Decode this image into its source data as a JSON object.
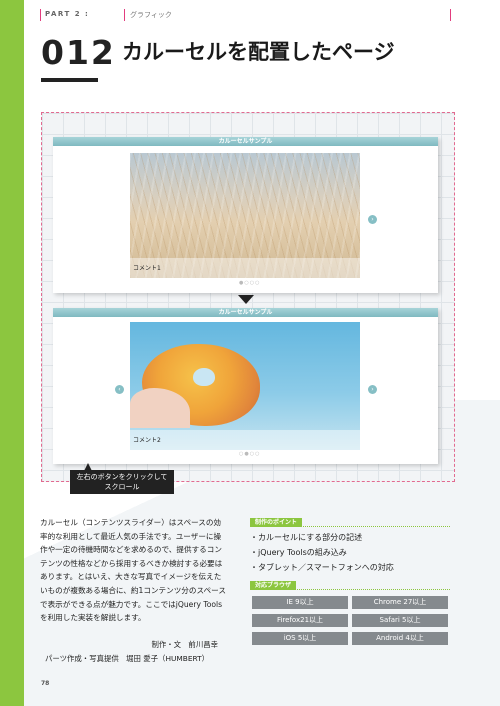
{
  "header": {
    "part": "PART 2 :",
    "category": "グラフィック",
    "number": "012",
    "title": "カルーセルを配置したページ"
  },
  "preview": {
    "carousel_top": {
      "heading": "カルーセルサンプル",
      "comment": "コメント1",
      "next_arrow": "›"
    },
    "carousel_bottom": {
      "heading": "カルーセルサンプル",
      "comment": "コメント2",
      "prev_arrow": "‹",
      "next_arrow": "›"
    },
    "callout_line1": "左右のボタンをクリックして",
    "callout_line2": "スクロール"
  },
  "body_text": "カルーセル（コンテンツスライダー）はスペースの効率的な利用として最近人気の手法です。ユーザーに操作や一定の待機時間などを求めるので、提供するコンテンツの性格などから採用するべきか検討する必要はあります。とはいえ、大きな写真でイメージを伝えたいものが複数ある場合に、約1コンテンツ分のスペースで表示ができる点が魅力です。ここではjQuery Toolsを利用した実装を解説します。",
  "credits": {
    "line1": "制作・文　前川昌幸",
    "line2": "パーツ作成・写真提供　堀田 愛子（HUMBERT）"
  },
  "points": {
    "label": "制作のポイント",
    "items": [
      "・カルーセルにする部分の記述",
      "・jQuery Toolsの組み込み",
      "・タブレット／スマートフォンへの対応"
    ]
  },
  "browsers": {
    "label": "対応ブラウザ",
    "items": [
      "IE 9以上",
      "Chrome 27以上",
      "Firefox21以上",
      "Safari 5以上",
      "iOS 5以上",
      "Android 4以上"
    ]
  },
  "page_number": "78",
  "colors": {
    "accent_green": "#8cc63f",
    "carousel_header": "#7fb9c0",
    "browser_badge": "#858a8e"
  }
}
